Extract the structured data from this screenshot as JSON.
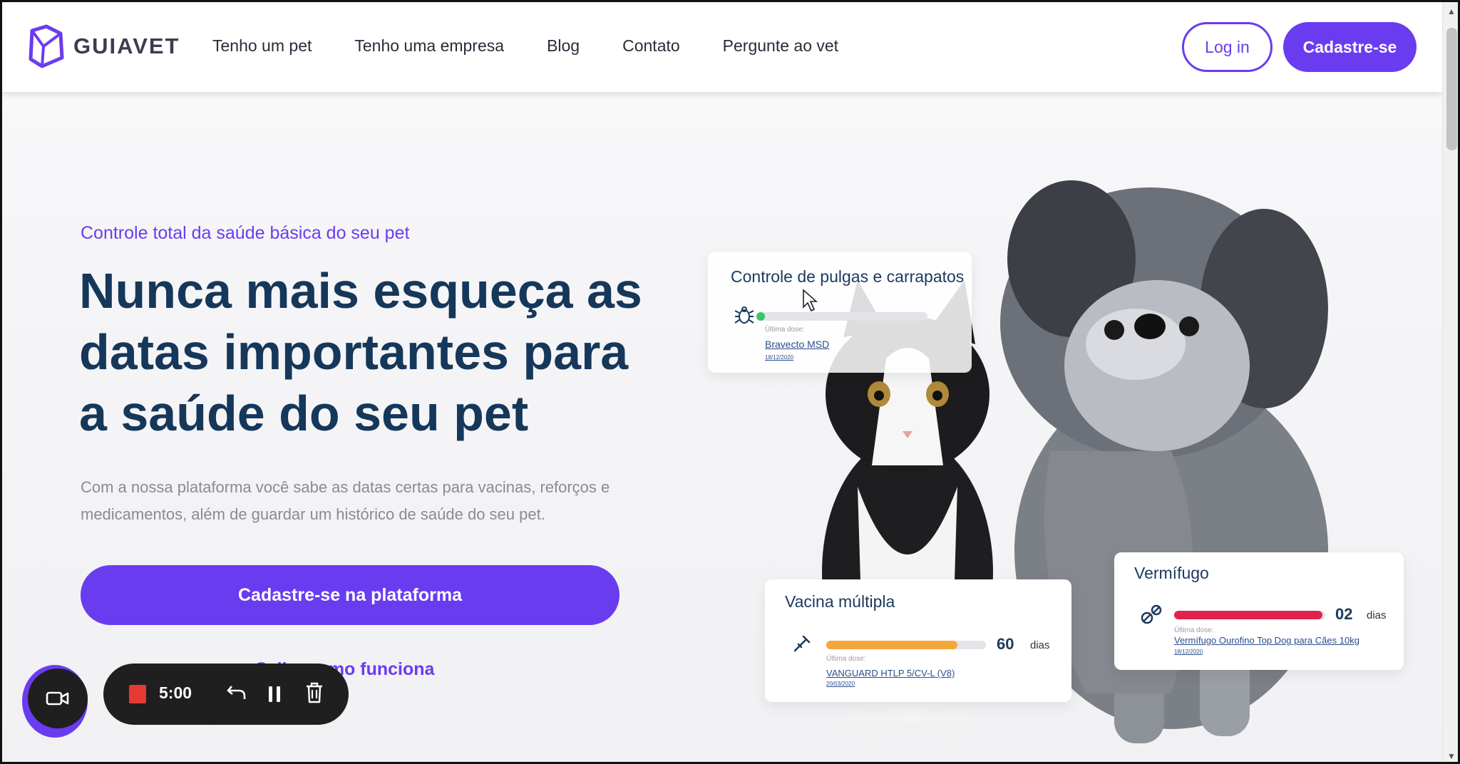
{
  "header": {
    "logo_text": "GUIAVET",
    "nav": [
      "Tenho um pet",
      "Tenho uma empresa",
      "Blog",
      "Contato",
      "Pergunte ao vet"
    ],
    "login_label": "Log in",
    "signup_label": "Cadastre-se"
  },
  "hero": {
    "eyebrow": "Controle total da saúde básica do seu pet",
    "title": "Nunca mais esqueça as datas importantes para a saúde do seu pet",
    "description": "Com a nossa plataforma você sabe as datas certas para vacinas, reforços e medicamentos, além de guardar um histórico de saúde do seu pet.",
    "cta_label": "Cadastre-se na plataforma",
    "how_label": "Saiba como funciona"
  },
  "cards": {
    "pulgas": {
      "title": "Controle de pulgas e carrapatos",
      "last_dose_label": "Última dose:",
      "product": "Bravecto MSD",
      "date": "18/12/2020",
      "progress": 0.05,
      "color": "#3cc46a"
    },
    "vacina": {
      "title": "Vacina múltipla",
      "days": "60",
      "days_unit": "dias",
      "last_dose_label": "Última dose:",
      "product": "VANGUARD HTLP 5/CV-L (V8)",
      "date": "20/03/2020",
      "progress": 0.82,
      "color": "#f5a63b"
    },
    "vermifugo": {
      "title": "Vermífugo",
      "days": "02",
      "days_unit": "dias",
      "last_dose_label": "Última dose:",
      "product": "Vermífugo Ourofino Top Dog para Cães 10kg",
      "date": "18/12/2020",
      "progress": 0.98,
      "color": "#e0234d"
    }
  },
  "recorder": {
    "time": "5:00"
  },
  "colors": {
    "accent": "#6a3cf0",
    "heading": "#15375a"
  }
}
